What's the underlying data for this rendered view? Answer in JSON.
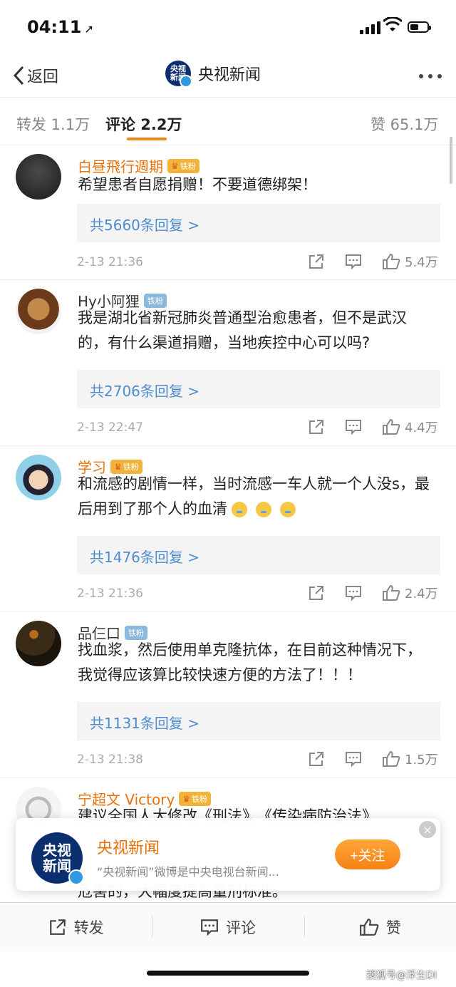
{
  "status_bar": {
    "time": "04:11",
    "arrow": "➚"
  },
  "nav": {
    "back_label": "返回",
    "title": "央视新闻",
    "logo_text_top": "央视",
    "logo_text_bottom": "新闻"
  },
  "tabs": {
    "repost": "转发 1.1万",
    "comment": "评论 2.2万",
    "like": "赞 65.1万"
  },
  "comments": [
    {
      "name": "白昼飛行週期",
      "badge": "铁粉",
      "text": "希望患者自愿捐赠！不要道德绑架！",
      "replies": "共5660条回复 >",
      "time": "2-13 21:36",
      "likes": "5.4万"
    },
    {
      "name": "Hy小阿狸",
      "badge": "铁粉",
      "text": "我是湖北省新冠肺炎普通型治愈患者，但不是武汉的，有什么渠道捐赠，当地疾控中心可以吗?",
      "replies": "共2706条回复 >",
      "time": "2-13 22:47",
      "likes": "4.4万"
    },
    {
      "name": "学习",
      "badge": "铁粉",
      "text": "和流感的剧情一样，当时流感一车人就一个人没s，最后用到了那个人的血清",
      "replies": "共1476条回复 >",
      "time": "2-13 21:36",
      "likes": "2.4万"
    },
    {
      "name": "品仨口",
      "badge": "铁粉",
      "text": "找血浆，然后使用单克隆抗体，在目前这种情况下，我觉得应该算比较快速方便的方法了！！！",
      "replies": "共1131条回复 >",
      "time": "2-13 21:38",
      "likes": "1.5万"
    },
    {
      "name": "宁超文 Victory",
      "badge": "铁粉",
      "text_line1": "建议全国人大修改《刑法》、《传染病防治法》",
      "text_line3": "危害的，大幅度提高量刑标准。"
    }
  ],
  "banner": {
    "name": "央视新闻",
    "desc": "“央视新闻”微博是中央电视台新闻...",
    "follow": "+关注",
    "close": "×"
  },
  "bottom_bar": {
    "repost": "转发",
    "comment": "评论",
    "like": "赞"
  },
  "watermark": "搜狐号@浮生DI",
  "colors": {
    "accent_orange": "#f08a1c",
    "link_blue": "#4e8ccf",
    "name_orange": "#e8720c",
    "brand_navy": "#0b2f6e"
  }
}
